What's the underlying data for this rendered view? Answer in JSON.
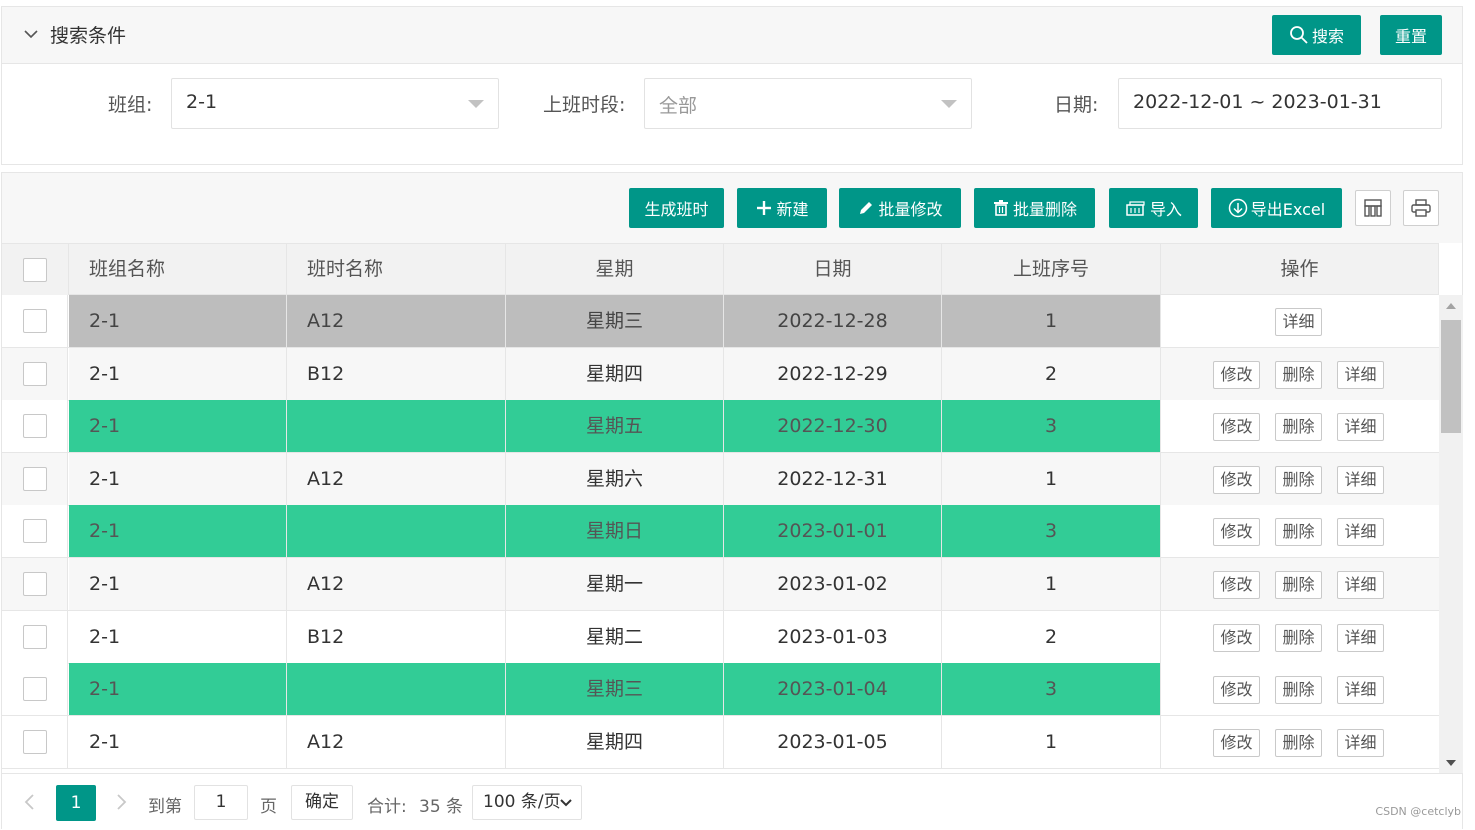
{
  "search": {
    "title": "搜索条件",
    "search_button": "搜索",
    "reset_button": "重置",
    "fields": {
      "team_label": "班组:",
      "team_value": "2-1",
      "period_label": "上班时段:",
      "period_value": "全部",
      "date_label": "日期:",
      "date_value": "2022-12-01 ~ 2023-01-31"
    }
  },
  "toolbar": {
    "generate": "生成班时",
    "new": "新建",
    "batch_edit": "批量修改",
    "batch_delete": "批量删除",
    "import": "导入",
    "export": "导出Excel",
    "columns_icon": "columns-icon",
    "print_icon": "print-icon",
    "accent": "#009688"
  },
  "table": {
    "headers": [
      "班组名称",
      "班时名称",
      "星期",
      "日期",
      "上班序号",
      "操作"
    ],
    "actions": {
      "edit": "修改",
      "delete": "删除",
      "detail": "详细"
    },
    "highlight_green": "#32cc96",
    "selected_gray": "#bdbdbd",
    "rows": [
      {
        "team": "2-1",
        "shift": "A12",
        "weekday": "星期三",
        "date": "2022-12-28",
        "seq": "1",
        "style": "selected"
      },
      {
        "team": "2-1",
        "shift": "B12",
        "weekday": "星期四",
        "date": "2022-12-29",
        "seq": "2",
        "style": "normal"
      },
      {
        "team": "2-1",
        "shift": "",
        "weekday": "星期五",
        "date": "2022-12-30",
        "seq": "3",
        "style": "green"
      },
      {
        "team": "2-1",
        "shift": "A12",
        "weekday": "星期六",
        "date": "2022-12-31",
        "seq": "1",
        "style": "normal"
      },
      {
        "team": "2-1",
        "shift": "",
        "weekday": "星期日",
        "date": "2023-01-01",
        "seq": "3",
        "style": "green"
      },
      {
        "team": "2-1",
        "shift": "A12",
        "weekday": "星期一",
        "date": "2023-01-02",
        "seq": "1",
        "style": "normal"
      },
      {
        "team": "2-1",
        "shift": "B12",
        "weekday": "星期二",
        "date": "2023-01-03",
        "seq": "2",
        "style": "normal"
      },
      {
        "team": "2-1",
        "shift": "",
        "weekday": "星期三",
        "date": "2023-01-04",
        "seq": "3",
        "style": "green"
      },
      {
        "team": "2-1",
        "shift": "A12",
        "weekday": "星期四",
        "date": "2023-01-05",
        "seq": "1",
        "style": "normal"
      }
    ]
  },
  "pager": {
    "current_page": "1",
    "goto_label": "到第",
    "goto_value": "1",
    "page_unit": "页",
    "confirm": "确定",
    "total_label": "合计:",
    "total_value": "35 条",
    "page_size": "100 条/页"
  },
  "watermark": "CSDN @cetclyb"
}
